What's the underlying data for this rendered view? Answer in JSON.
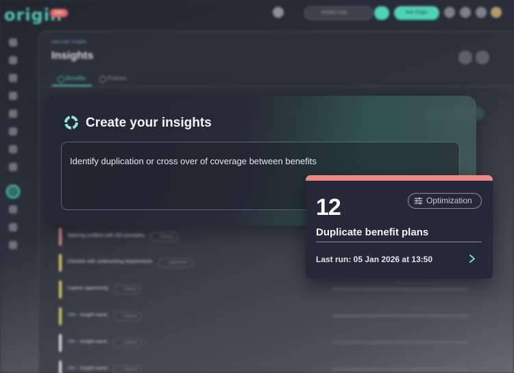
{
  "app": {
    "logo": "origin",
    "logo_badge": "beta",
    "workspace_select": "Global Corp",
    "primary_action": "Ask Origin"
  },
  "page": {
    "breadcrumb": "Data Intel / Insights",
    "title": "Insights",
    "tabs": [
      {
        "label": "Benefits",
        "active": true
      },
      {
        "label": "Policies",
        "active": false
      }
    ]
  },
  "background_rows": [
    {
      "title": "Tailoring conflicts with DEI principles",
      "tag": "Strategy",
      "accent": "#d98a8f"
    },
    {
      "title": "Clientele with underwriting requirements",
      "tag": "Optimization",
      "accent": "#d9c46a"
    },
    {
      "title": "Captive opportunity",
      "tag": "Pooling",
      "accent": "#d9c46a"
    },
    {
      "title": "<X> - insight name",
      "tag": "Category",
      "accent": "#d9c46a"
    },
    {
      "title": "<X> - insight name",
      "tag": "Category",
      "accent": "#d8d8d8"
    },
    {
      "title": "<X> - insight name",
      "tag": "Category",
      "accent": "#d8d8d8"
    }
  ],
  "create_card": {
    "title": "Create your insights",
    "prompt": "Identify duplication or cross over of coverage between benefits"
  },
  "result_card": {
    "count": "12",
    "category": "Optimization",
    "title": "Duplicate benefit plans",
    "last_run": "Last run: 05 Jan 2026 at 13:50",
    "accent_color": "#ee8a83"
  },
  "colors": {
    "brand": "#4fc7b3",
    "card_bg": "#242838"
  },
  "icons": {
    "create": "insight-ring-icon",
    "category": "sliders-icon",
    "open": "chevron-right-icon"
  }
}
